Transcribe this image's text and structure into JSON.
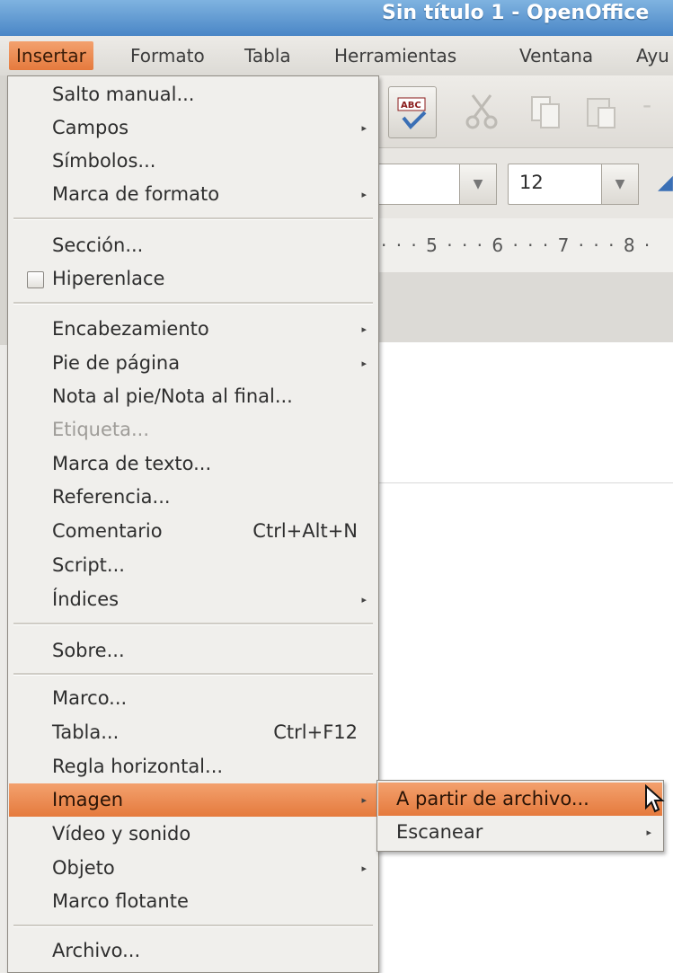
{
  "window": {
    "title": "Sin título 1 - OpenOffice"
  },
  "menubar": [
    {
      "label": "Insertar",
      "active": true
    },
    {
      "label": "Formato"
    },
    {
      "label": "Tabla"
    },
    {
      "label": "Herramientas"
    },
    {
      "label": "Ventana"
    },
    {
      "label": "Ayu"
    }
  ],
  "toolbar": {
    "font_size": "12",
    "ruler_text": "· · · 5 · · · 6 · · · 7 · · · 8 ·"
  },
  "insert_menu": {
    "salto_manual": "Salto manual...",
    "campos": "Campos",
    "simbolos": "Símbolos...",
    "marca_formato": "Marca de formato",
    "seccion": "Sección...",
    "hiperenlace": "Hiperenlace",
    "encabezamiento": "Encabezamiento",
    "pie_pagina": "Pie de página",
    "nota_pie": "Nota al pie/Nota al final...",
    "etiqueta": "Etiqueta...",
    "marca_texto": "Marca de texto...",
    "referencia": "Referencia...",
    "comentario": "Comentario",
    "comentario_shortcut": "Ctrl+Alt+N",
    "script": "Script...",
    "indices": "Índices",
    "sobre": "Sobre...",
    "marco": "Marco...",
    "tabla": "Tabla...",
    "tabla_shortcut": "Ctrl+F12",
    "regla": "Regla horizontal...",
    "imagen": "Imagen",
    "video": "Vídeo y sonido",
    "objeto": "Objeto",
    "marco_flotante": "Marco flotante",
    "archivo": "Archivo..."
  },
  "imagen_submenu": {
    "a_partir": "A partir de archivo...",
    "escanear": "Escanear"
  },
  "icons": [
    "spellcheck-icon",
    "cut-icon",
    "copy-icon",
    "paste-icon",
    "checkbox-icon",
    "submenu-arrow-icon",
    "mouse-cursor-icon"
  ],
  "colors": {
    "highlight": "#e57a3d",
    "titlebar": "#4a86c6"
  }
}
